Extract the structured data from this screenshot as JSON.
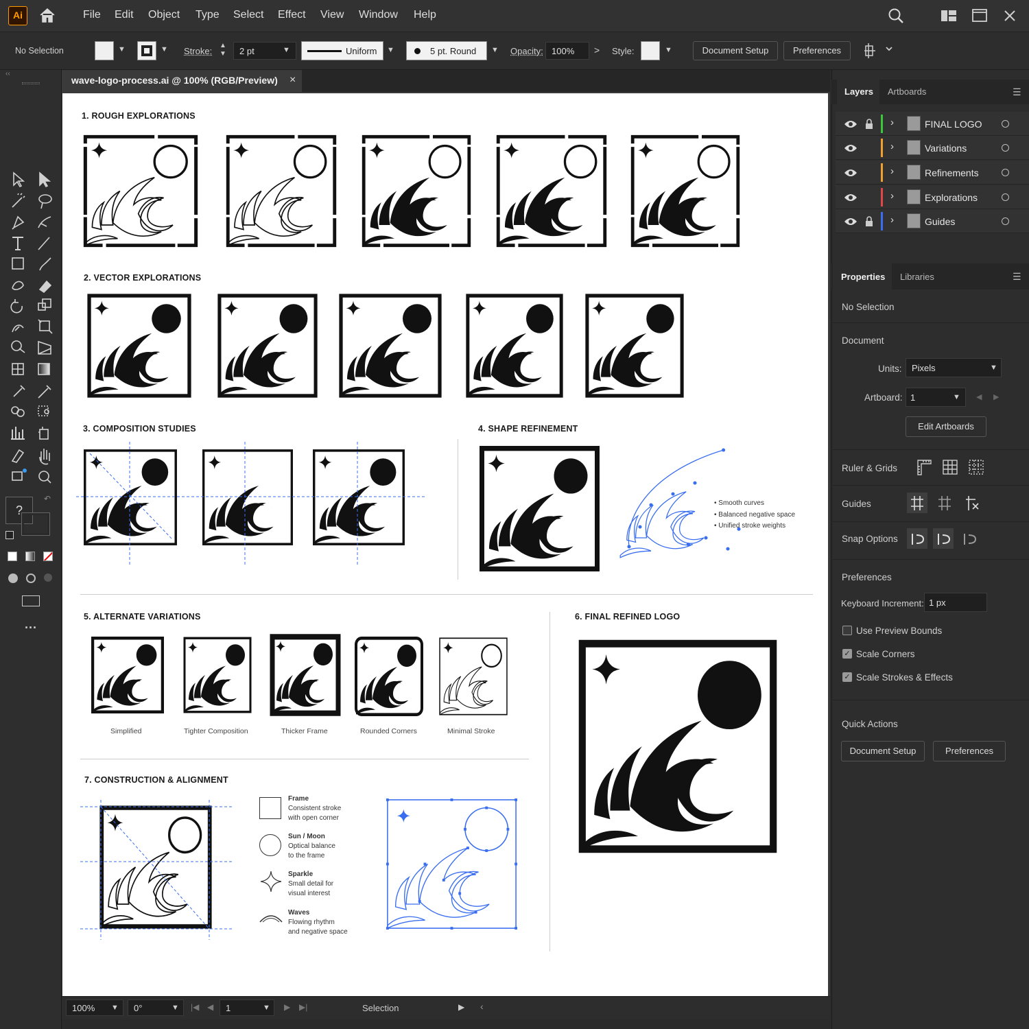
{
  "menubar": {
    "app_icon": "Ai",
    "items": [
      "File",
      "Edit",
      "Object",
      "Type",
      "Select",
      "Effect",
      "View",
      "Window",
      "Help"
    ],
    "icons": [
      "home-icon",
      "search-icon",
      "arrange-documents-icon",
      "window-icon",
      "close-icon"
    ]
  },
  "controlbar": {
    "selection": "No Selection",
    "stroke_label": "Stroke:",
    "stroke_value": "2 pt",
    "profile": "Uniform",
    "brush": "5 pt. Round",
    "opacity_label": "Opacity:",
    "opacity_value": "100%",
    "style_label": "Style:",
    "document_setup": "Document Setup",
    "preferences": "Preferences"
  },
  "document": {
    "tab_title": "wave-logo-process.ai @ 100% (RGB/Preview)"
  },
  "artboard": {
    "s1": "1. ROUGH EXPLORATIONS",
    "s2": "2. VECTOR EXPLORATIONS",
    "s3": "3. COMPOSITION STUDIES",
    "s4": "4. SHAPE REFINEMENT",
    "s4_notes": [
      "Smooth curves",
      "Balanced negative space",
      "Unified stroke weights"
    ],
    "s5": "5. ALTERNATE VARIATIONS",
    "s5_captions": [
      "Simplified",
      "Tighter Composition",
      "Thicker Frame",
      "Rounded Corners",
      "Minimal Stroke"
    ],
    "s6": "6. FINAL REFINED LOGO",
    "s7": "7. CONSTRUCTION & ALIGNMENT",
    "s7_legend": [
      {
        "title": "Frame",
        "l1": "Consistent stroke",
        "l2": "with open corner"
      },
      {
        "title": "Sun / Moon",
        "l1": "Optical balance",
        "l2": "to the frame"
      },
      {
        "title": "Sparkle",
        "l1": "Small detail for",
        "l2": "visual interest"
      },
      {
        "title": "Waves",
        "l1": "Flowing rhythm",
        "l2": "and negative space"
      }
    ]
  },
  "layers": {
    "tabs": [
      "Layers",
      "Artboards"
    ],
    "items": [
      {
        "name": "FINAL LOGO",
        "color": "#3cc83c",
        "locked": true
      },
      {
        "name": "Variations",
        "color": "#f0a030",
        "locked": false
      },
      {
        "name": "Refinements",
        "color": "#f0a030",
        "locked": false
      },
      {
        "name": "Explorations",
        "color": "#e04848",
        "locked": false
      },
      {
        "name": "Guides",
        "color": "#3a6ef0",
        "locked": true
      }
    ]
  },
  "properties": {
    "tabs": [
      "Properties",
      "Libraries"
    ],
    "selection": "No Selection",
    "document": "Document",
    "units_label": "Units:",
    "units_value": "Pixels",
    "artboard_label": "Artboard:",
    "artboard_value": "1",
    "edit_artboards": "Edit Artboards",
    "ruler_grids": "Ruler & Grids",
    "guides": "Guides",
    "snap_options": "Snap Options",
    "preferences": "Preferences",
    "keyboard_increment_label": "Keyboard Increment:",
    "keyboard_increment_value": "1 px",
    "use_preview_bounds": "Use Preview Bounds",
    "scale_corners": "Scale Corners",
    "scale_strokes": "Scale Strokes & Effects",
    "quick_actions": "Quick Actions",
    "qa_document_setup": "Document Setup",
    "qa_preferences": "Preferences"
  },
  "statusbar": {
    "zoom": "100%",
    "rotation": "0°",
    "artboard": "1",
    "tool": "Selection"
  },
  "colors": {
    "accent": "#ff9a00",
    "guide_blue": "#3a6ef0"
  }
}
